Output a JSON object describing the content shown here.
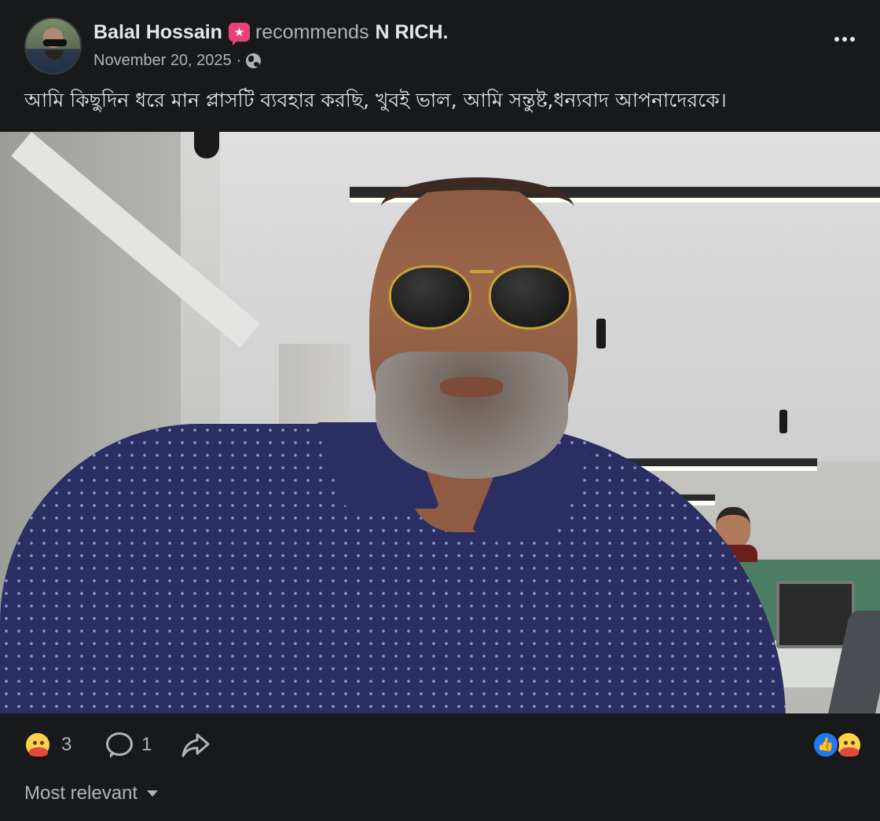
{
  "post": {
    "author_name": "Balal Hossain",
    "action_text": "recommends",
    "page_name": "N RICH.",
    "date": "November 20, 2025",
    "separator": "·",
    "audience_icon": "globe-icon",
    "text": "আমি কিছুদিন ধরে মান প্লাসটি ব্যবহার করছি, খুবই ভাল, আমি সন্তুষ্ট,ধন্যবাদ আপনাদেরকে।"
  },
  "reactions": {
    "reaction_icon": "hugging-face-icon",
    "reaction_count": "3",
    "comment_count": "1",
    "summary_icons": [
      "like-icon",
      "hugging-face-icon"
    ],
    "like_color": "#2078f4"
  },
  "comments": {
    "sort_label": "Most relevant"
  },
  "colors": {
    "background": "#18191a",
    "primary_text": "#e4e6eb",
    "secondary_text": "#b0b3b8",
    "badge": "#e8427a"
  }
}
